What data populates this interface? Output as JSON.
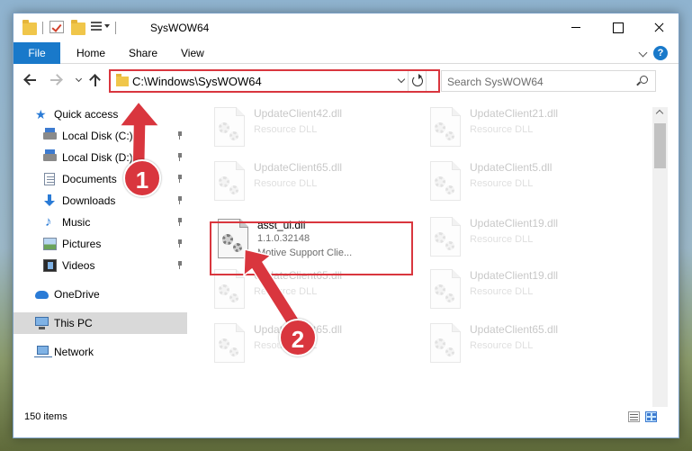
{
  "window": {
    "title": "SysWOW64"
  },
  "ribbon": {
    "tabs": [
      "File",
      "Home",
      "Share",
      "View"
    ],
    "help_label": "?"
  },
  "navbar": {
    "address": "C:\\Windows\\SysWOW64",
    "search_placeholder": "Search SysWOW64"
  },
  "sidebar": {
    "items": [
      {
        "label": "Quick access",
        "icon": "star-icon"
      },
      {
        "label": "Local Disk (C:)",
        "icon": "drive-icon"
      },
      {
        "label": "Local Disk (D:)",
        "icon": "drive-icon"
      },
      {
        "label": "Documents",
        "icon": "documents-icon"
      },
      {
        "label": "Downloads",
        "icon": "downloads-icon"
      },
      {
        "label": "Music",
        "icon": "music-icon"
      },
      {
        "label": "Pictures",
        "icon": "pictures-icon"
      },
      {
        "label": "Videos",
        "icon": "videos-icon"
      },
      {
        "label": "OneDrive",
        "icon": "onedrive-icon"
      },
      {
        "label": "This PC",
        "icon": "this-pc-icon"
      },
      {
        "label": "Network",
        "icon": "network-icon"
      }
    ]
  },
  "files": [
    {
      "name": "UpdateClient42.dll",
      "desc": "Resource DLL"
    },
    {
      "name": "UpdateClient21.dll",
      "desc": "Resource DLL"
    },
    {
      "name": "UpdateClient65.dll",
      "desc": "Resource DLL"
    },
    {
      "name": "UpdateClient5.dll",
      "desc": "Resource DLL"
    },
    {
      "name": "asst_ui.dll",
      "version": "1.1.0.32148",
      "desc": "Motive Support Clie..."
    },
    {
      "name": "UpdateClient19.dll",
      "desc": "Resource DLL"
    },
    {
      "name": "UpdateClient65.dll",
      "desc": "Resource DLL"
    },
    {
      "name": "UpdateClient19.dll",
      "desc": "Resource DLL"
    },
    {
      "name": "UpdateClient65.dll",
      "desc": "Resource DLL"
    },
    {
      "name": "UpdateClient65.dll",
      "desc": "Resource DLL"
    }
  ],
  "status": {
    "item_count": "150 items"
  },
  "annotations": {
    "step1": "1",
    "step2": "2",
    "color": "#d9363e"
  }
}
